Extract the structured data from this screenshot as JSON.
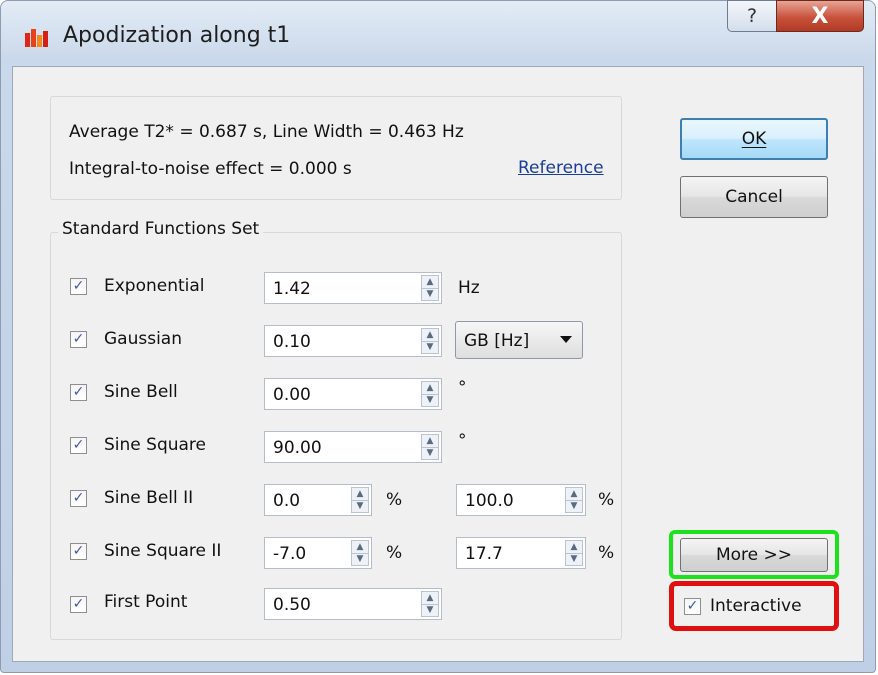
{
  "window": {
    "title": "Apodization along t1",
    "help_glyph": "?",
    "close_glyph": "X"
  },
  "info": {
    "line1": "Average T2* = 0.687 s, Line Width = 0.463 Hz",
    "line2": "Integral-to-noise effect = 0.000 s",
    "reference_link": "Reference"
  },
  "buttons": {
    "ok": "OK",
    "cancel": "Cancel",
    "more": "More >>"
  },
  "interactive": {
    "label": "Interactive",
    "checked": true
  },
  "group": {
    "title": "Standard Functions Set",
    "rows": [
      {
        "label": "Exponential",
        "checked": true,
        "value": "1.42",
        "unit": "Hz"
      },
      {
        "label": "Gaussian",
        "checked": true,
        "value": "0.10",
        "combo": "GB [Hz]"
      },
      {
        "label": "Sine Bell",
        "checked": true,
        "value": "0.00",
        "unit": "°"
      },
      {
        "label": "Sine Square",
        "checked": true,
        "value": "90.00",
        "unit": "°"
      },
      {
        "label": "Sine Bell II",
        "checked": true,
        "value": "0.0",
        "unit": "%",
        "value2": "100.0",
        "unit2": "%"
      },
      {
        "label": "Sine Square II",
        "checked": true,
        "value": "-7.0",
        "unit": "%",
        "value2": "17.7",
        "unit2": "%"
      },
      {
        "label": "First Point",
        "checked": true,
        "value": "0.50"
      }
    ]
  },
  "colors": {
    "highlight_more": "#1ee11e",
    "highlight_interactive": "#e11010",
    "link": "#1a3c9c"
  },
  "icons": {
    "app": "app-logo-icon",
    "checkbox": "checkmark-icon",
    "spin": "spin-arrows-icon",
    "dropdown": "chevron-down-icon"
  }
}
